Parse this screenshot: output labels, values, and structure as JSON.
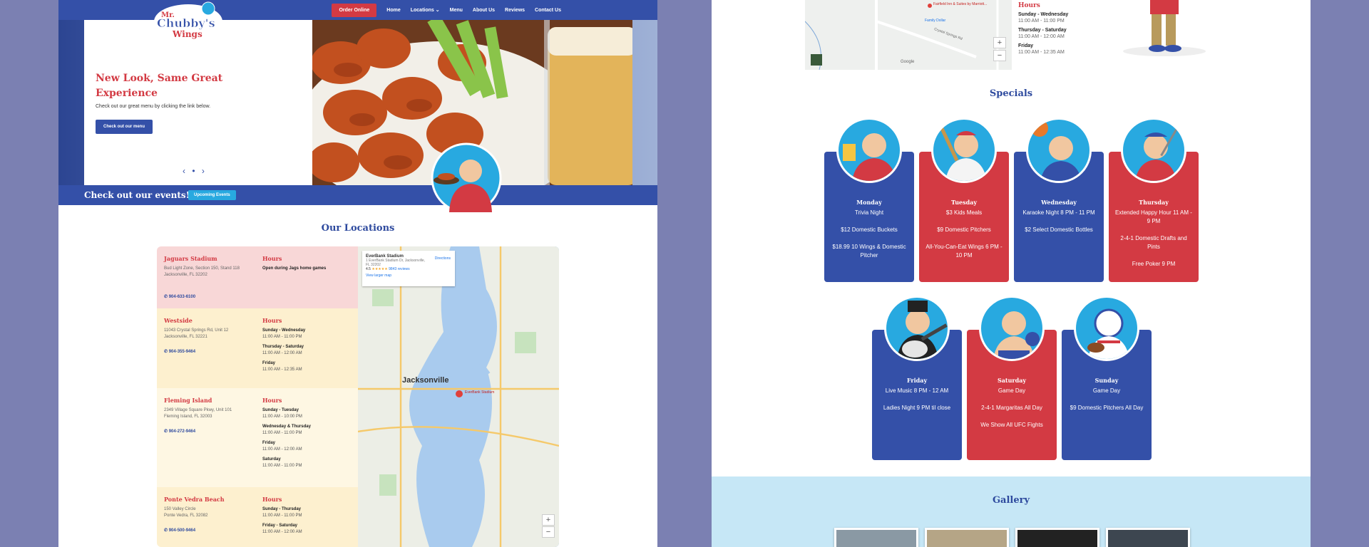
{
  "nav": {
    "order": "Order Online",
    "home": "Home",
    "locations": "Locations",
    "menu": "Menu",
    "about": "About Us",
    "reviews": "Reviews",
    "contact": "Contact Us"
  },
  "logo": {
    "line1": "Mr.",
    "line2": "Chubby's",
    "line3": "Wings"
  },
  "hero": {
    "title": "New Look, Same Great Experience",
    "subtitle": "Check out our great menu by clicking the link below.",
    "button": "Check out our menu"
  },
  "events": {
    "text": "Check out our events!",
    "button": "Upcoming Events"
  },
  "locations": {
    "title": "Our Locations",
    "hours_label": "Hours",
    "items": [
      {
        "name": "Jaguars Stadium",
        "addr1": "Bud Light Zone, Section 150, Stand 118",
        "addr2": "Jacksonville, FL 32202",
        "phone": "904-633-6100",
        "hours": [
          {
            "days": "Open during Jags home games",
            "time": ""
          }
        ]
      },
      {
        "name": "Westside",
        "addr1": "11043 Crystal Springs Rd, Unit 12",
        "addr2": "Jacksonville, FL 32221",
        "phone": "904-355-9464",
        "hours": [
          {
            "days": "Sunday - Wednesday",
            "time": "11:00 AM - 11:00 PM"
          },
          {
            "days": "Thursday - Saturday",
            "time": "11:00 AM - 12:00 AM"
          },
          {
            "days": "Friday",
            "time": "11:00 AM - 12:35 AM"
          }
        ]
      },
      {
        "name": "Fleming Island",
        "addr1": "2349 Village Square Pkwy, Unit 101",
        "addr2": "Fleming Island, FL 32003",
        "phone": "904-272-9464",
        "hours": [
          {
            "days": "Sunday - Tuesday",
            "time": "11:00 AM - 10:00 PM"
          },
          {
            "days": "Wednesday & Thursday",
            "time": "11:00 AM - 11:00 PM"
          },
          {
            "days": "Friday",
            "time": "11:00 AM - 12:00 AM"
          },
          {
            "days": "Saturday",
            "time": "11:00 AM - 11:00 PM"
          }
        ]
      },
      {
        "name": "Ponte Vedra Beach",
        "addr1": "150 Valley Circle",
        "addr2": "Ponte Vedra, FL 32082",
        "phone": "904-500-9464",
        "hours": [
          {
            "days": "Sunday - Thursday",
            "time": "11:00 AM - 11:00 PM"
          },
          {
            "days": "Friday - Saturday",
            "time": "11:00 AM - 12:00 AM"
          }
        ]
      }
    ]
  },
  "map": {
    "place": "EverBank Stadium",
    "address": "1 EverBank Stadium Dr, Jacksonville, FL 32202",
    "rating": "4.5",
    "reviews": "9843 reviews",
    "larger": "View larger map",
    "directions": "Directions",
    "city": "Jacksonville",
    "pin": "EverBank Stadium"
  },
  "right_map": {
    "poi1": "Fairfield Inn & Suites by Marriott...",
    "poi2": "Family Dollar",
    "road": "Crystal Springs Rd",
    "google": "Google"
  },
  "right_hours": {
    "label": "Hours",
    "items": [
      {
        "days": "Sunday - Wednesday",
        "time": "11:00 AM - 11:00 PM"
      },
      {
        "days": "Thursday - Saturday",
        "time": "11:00 AM - 12:00 AM"
      },
      {
        "days": "Friday",
        "time": "11:00 AM - 12:35 AM"
      }
    ]
  },
  "specials": {
    "title": "Specials",
    "cards": [
      {
        "day": "Monday",
        "deals": [
          "Trivia Night",
          "$12 Domestic Buckets",
          "$18.99 10 Wings & Domestic Pitcher"
        ]
      },
      {
        "day": "Tuesday",
        "deals": [
          "$3 Kids Meals",
          "$9 Domestic Pitchers",
          "All-You-Can-Eat Wings 6 PM - 10 PM"
        ]
      },
      {
        "day": "Wednesday",
        "deals": [
          "Karaoke Night 8 PM - 11 PM",
          "$2 Select Domestic Bottles"
        ]
      },
      {
        "day": "Thursday",
        "deals": [
          "Extended Happy Hour 11 AM - 9 PM",
          "2-4-1 Domestic Drafts and Pints",
          "Free Poker 9 PM"
        ]
      },
      {
        "day": "Friday",
        "deals": [
          "Live Music 8 PM - 12 AM",
          "Ladies Night 9 PM til close"
        ]
      },
      {
        "day": "Saturday",
        "deals": [
          "Game Day",
          "2-4-1 Margaritas All Day",
          "We Show All UFC Fights"
        ]
      },
      {
        "day": "Sunday",
        "deals": [
          "Game Day",
          "$9 Domestic Pitchers All Day"
        ]
      }
    ]
  },
  "gallery": {
    "title": "Gallery"
  }
}
